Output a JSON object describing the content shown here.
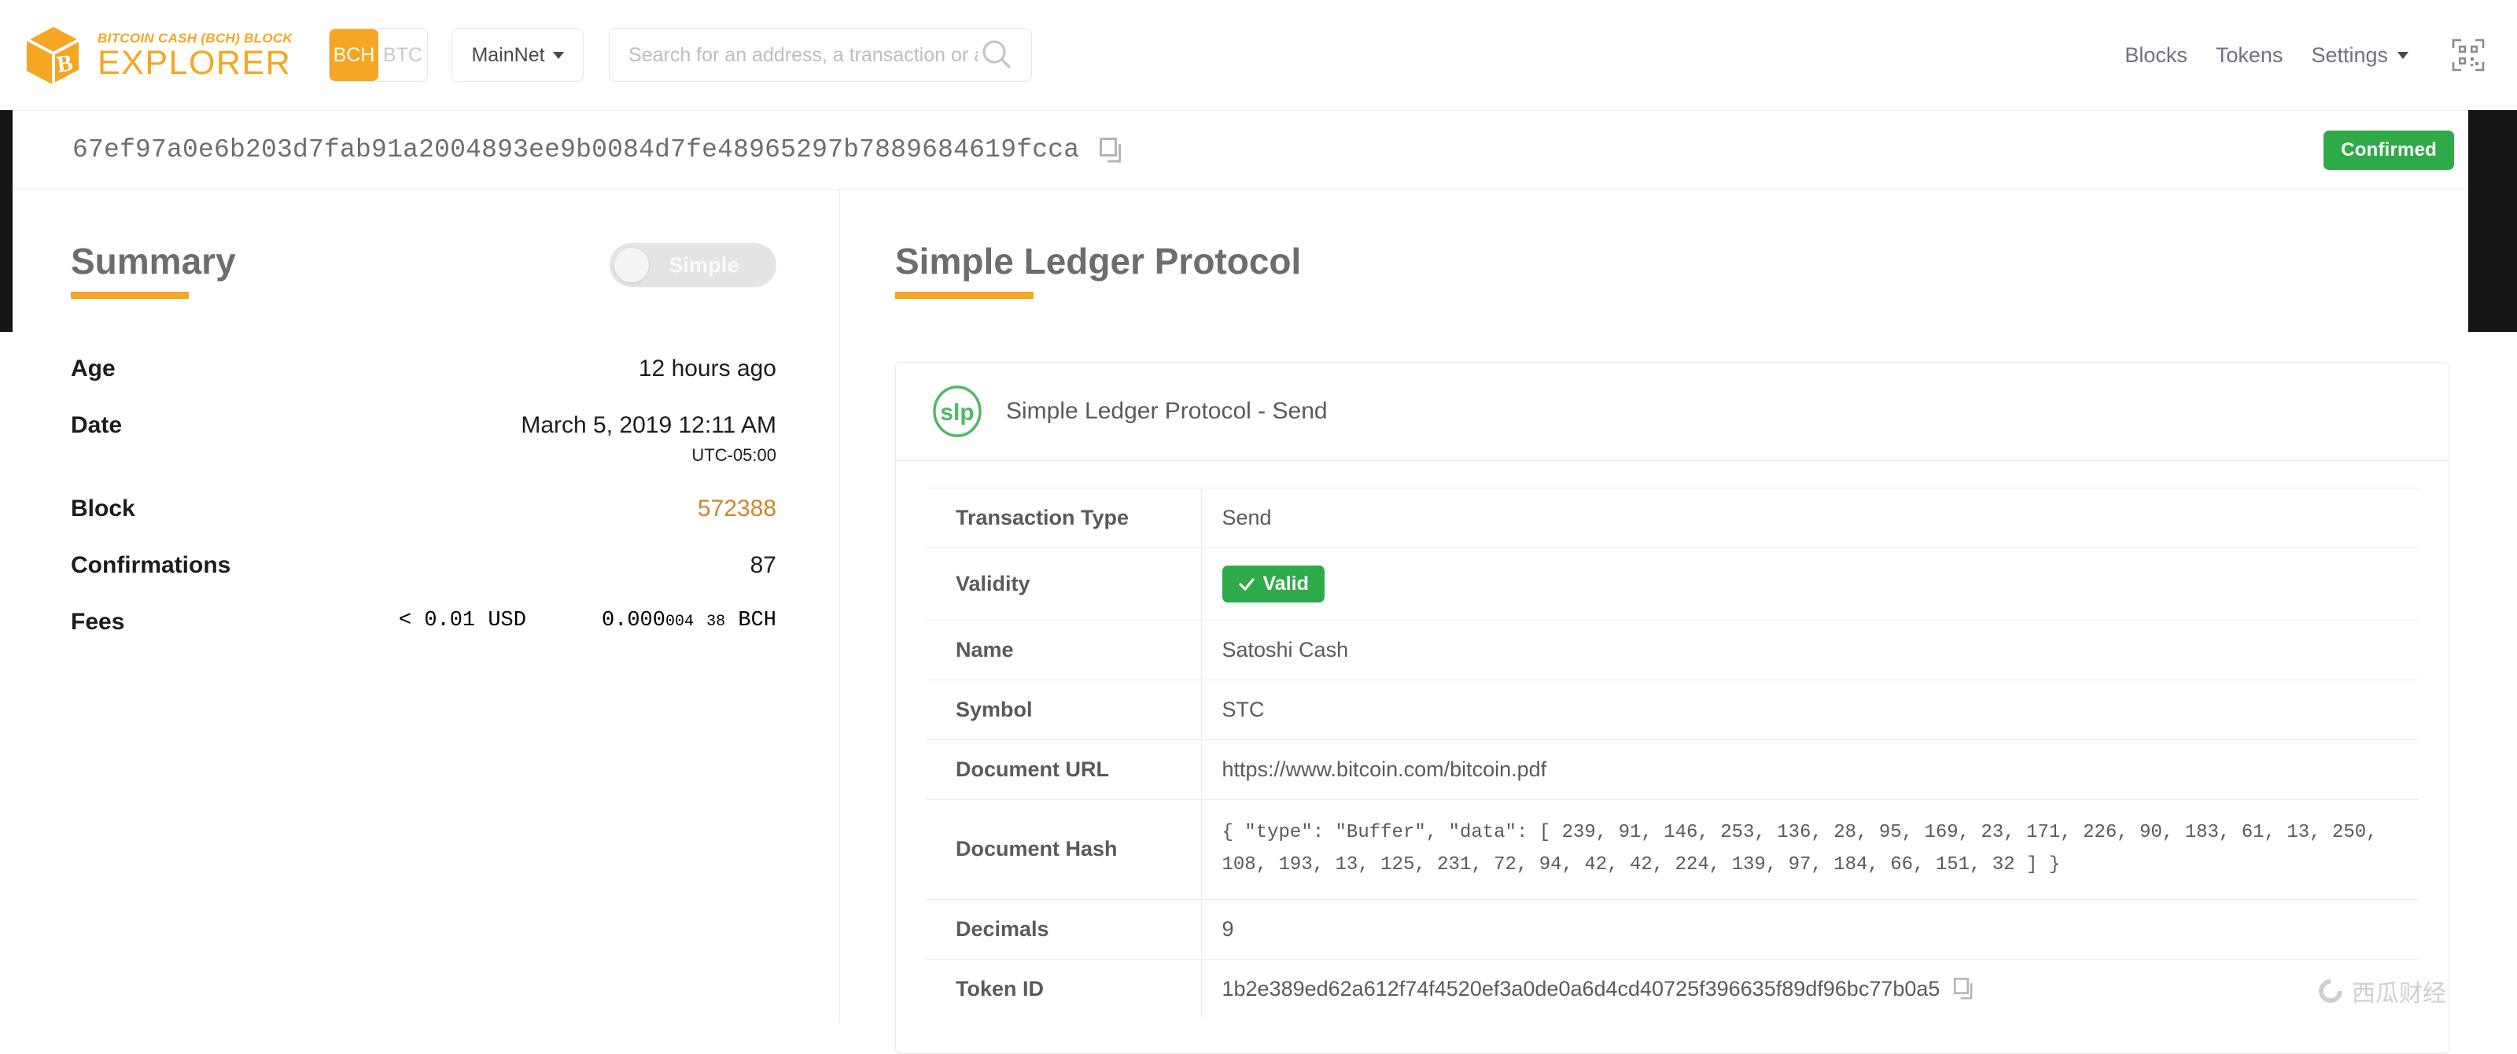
{
  "header": {
    "brand": {
      "kicker": "BITCOIN CASH (BCH) BLOCK",
      "title": "EXPLORER",
      "logo_icon": "cube-bitcoin-icon"
    },
    "currency_toggle": {
      "active": "BCH",
      "inactive": "BTC"
    },
    "network_select": {
      "value": "MainNet",
      "caret_icon": "chevron-down-icon"
    },
    "search": {
      "value": "",
      "placeholder": "Search for an address, a transaction or a block hash",
      "icon": "search-icon"
    },
    "nav": [
      {
        "label": "Blocks"
      },
      {
        "label": "Tokens"
      },
      {
        "label": "Settings",
        "caret_icon": "chevron-down-icon"
      }
    ],
    "qr_icon": "qr-code-icon"
  },
  "txid_bar": {
    "txid": "67ef97a0e6b203d7fab91a2004893ee9b0084d7fe48965297b7889684619fcca",
    "copy_icon": "copy-icon",
    "status_badge": "Confirmed",
    "status_color": "#2eab48"
  },
  "summary": {
    "title": "Summary",
    "toggle": {
      "label": "Simple",
      "state": "off"
    },
    "rows": [
      {
        "label": "Age",
        "value": "12 hours ago"
      },
      {
        "label": "Date",
        "value": "March 5, 2019 12:11 AM",
        "sub": "UTC-05:00"
      },
      {
        "label": "Block",
        "value": "572388",
        "link": true
      },
      {
        "label": "Confirmations",
        "value": "87"
      }
    ],
    "fees": {
      "label": "Fees",
      "usd_prefix": "<",
      "usd_amount": "0.01",
      "usd_unit": "USD",
      "bch_main": "0.000",
      "bch_group1": "004",
      "bch_group2": "38",
      "bch_unit": "BCH"
    }
  },
  "slp": {
    "title": "Simple Ledger Protocol",
    "card_title": "Simple Ledger Protocol - Send",
    "logo_icon": "slp-logo-icon",
    "accent_color": "#f5a623",
    "rows": [
      {
        "key": "Transaction Type",
        "value": "Send",
        "type": "text"
      },
      {
        "key": "Validity",
        "value": "Valid",
        "type": "badge",
        "check_icon": "check-icon"
      },
      {
        "key": "Name",
        "value": "Satoshi Cash",
        "type": "text"
      },
      {
        "key": "Symbol",
        "value": "STC",
        "type": "text"
      },
      {
        "key": "Document URL",
        "value": "https://www.bitcoin.com/bitcoin.pdf",
        "type": "text"
      },
      {
        "key": "Document Hash",
        "value": "{ \"type\": \"Buffer\", \"data\": [ 239, 91, 146, 253, 136, 28, 95, 169, 23, 171, 226, 90, 183, 61, 13, 250, 108, 193, 13, 125, 231, 72, 94, 42, 42, 224, 139, 97, 184, 66, 151, 32 ] }",
        "type": "mono"
      },
      {
        "key": "Decimals",
        "value": "9",
        "type": "text"
      },
      {
        "key": "Token ID",
        "value": "1b2e389ed62a612f74f4520ef3a0de0a6d4cd40725f396635f89df96bc77b0a5",
        "type": "token",
        "copy_icon": "copy-icon"
      }
    ]
  },
  "watermark": {
    "text": "西瓜财经",
    "icon": "ring-icon"
  }
}
